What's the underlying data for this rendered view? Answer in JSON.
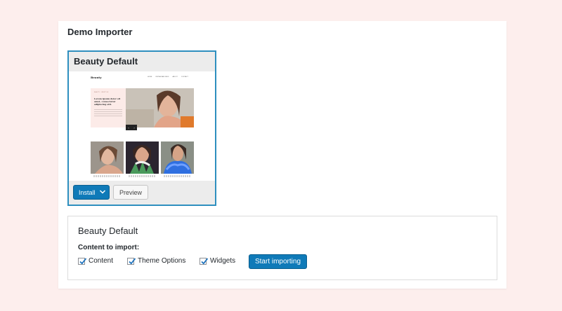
{
  "page": {
    "title": "Demo Importer"
  },
  "demo_card": {
    "title": "Beauty Default",
    "install_label": "Install",
    "preview_label": "Preview",
    "thumbnail": {
      "logo": "Beauty",
      "nav": [
        "HOME",
        "INSTAGRAM FEED",
        "ABOUT",
        "CONTACT"
      ],
      "hero_kicker": "BEAUTY · LIFESTYLE",
      "hero_text": "Lorem ipsum dolor sit amet, consectetur adipiscing elit."
    }
  },
  "importer": {
    "title": "Beauty Default",
    "content_label": "Content to import:",
    "options": [
      {
        "label": "Content",
        "checked": true
      },
      {
        "label": "Theme Options",
        "checked": true
      },
      {
        "label": "Widgets",
        "checked": true
      }
    ],
    "start_label": "Start importing"
  },
  "colors": {
    "background": "#fdeeed",
    "accent": "#0f7ab8",
    "card_border": "#2e8fbf"
  }
}
